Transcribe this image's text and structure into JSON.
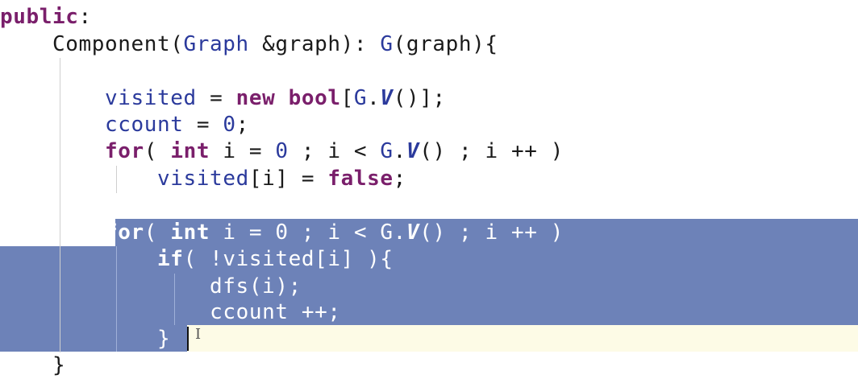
{
  "editor": {
    "language": "cpp",
    "colors": {
      "keyword": "#7a1f6b",
      "field": "#2b3a9c",
      "selection": "#6d82b8",
      "current_line": "#fdfbe6"
    },
    "lines": {
      "l1": {
        "kw1": "public",
        "t1": ":"
      },
      "l2": {
        "t1": "    Component(",
        "ty1": "Graph",
        "t2": " &graph): ",
        "fld1": "G",
        "t3": "(graph){"
      },
      "l3": {
        "t1": ""
      },
      "l4": {
        "t1": "        ",
        "fld1": "visited",
        "t2": " = ",
        "kw1": "new",
        "t3": " ",
        "ty1": "bool",
        "t4": "[",
        "fld2": "G",
        "t5": ".",
        "meth1": "V",
        "t6": "()];"
      },
      "l5": {
        "t1": "        ",
        "fld1": "ccount",
        "t2": " = ",
        "num1": "0",
        "t3": ";"
      },
      "l6": {
        "t1": "        ",
        "kw1": "for",
        "t2": "( ",
        "ty1": "int",
        "t3": " i = ",
        "num1": "0",
        "t4": " ; i < ",
        "fld1": "G",
        "t5": ".",
        "meth1": "V",
        "t6": "() ; i ++ )"
      },
      "l7": {
        "t1": "            ",
        "fld1": "visited",
        "t2": "[i] = ",
        "kw1": "false",
        "t3": ";"
      },
      "l8": {
        "t1": ""
      },
      "l9": {
        "t1": "        ",
        "kw1": "for",
        "t2": "( ",
        "ty1": "int",
        "t3": " i = ",
        "num1": "0",
        "t4": " ; i < ",
        "fld1": "G",
        "t5": ".",
        "meth1": "V",
        "t6": "() ; i ++ )"
      },
      "l10": {
        "t1": "            ",
        "kw1": "if",
        "t2": "( !",
        "fld1": "visited",
        "t3": "[i] ){"
      },
      "l11": {
        "t1": "                dfs(i);"
      },
      "l12": {
        "t1": "                ",
        "fld1": "ccount",
        "t2": " ++;"
      },
      "l13": {
        "t1": "            }"
      },
      "l14": {
        "t1": "    }"
      }
    },
    "cursor_glyph": "I"
  }
}
